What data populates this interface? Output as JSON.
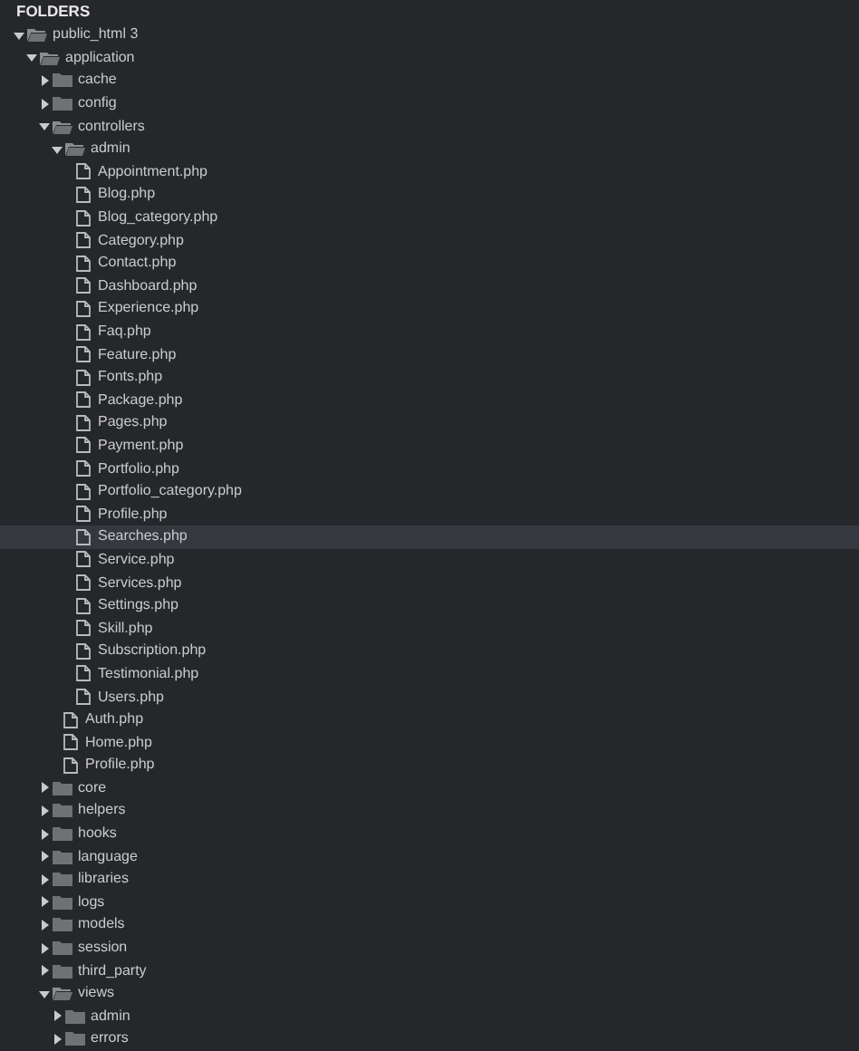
{
  "sidebar": {
    "title": "FOLDERS",
    "tree": [
      {
        "kind": "folder",
        "name": "public_html 3",
        "expanded": true,
        "selected": false,
        "children": [
          {
            "kind": "folder",
            "name": "application",
            "expanded": true,
            "selected": false,
            "children": [
              {
                "kind": "folder",
                "name": "cache",
                "expanded": false,
                "selected": false
              },
              {
                "kind": "folder",
                "name": "config",
                "expanded": false,
                "selected": false
              },
              {
                "kind": "folder",
                "name": "controllers",
                "expanded": true,
                "selected": false,
                "children": [
                  {
                    "kind": "folder",
                    "name": "admin",
                    "expanded": true,
                    "selected": false,
                    "children": [
                      {
                        "kind": "file",
                        "name": "Appointment.php",
                        "selected": false
                      },
                      {
                        "kind": "file",
                        "name": "Blog.php",
                        "selected": false
                      },
                      {
                        "kind": "file",
                        "name": "Blog_category.php",
                        "selected": false
                      },
                      {
                        "kind": "file",
                        "name": "Category.php",
                        "selected": false
                      },
                      {
                        "kind": "file",
                        "name": "Contact.php",
                        "selected": false
                      },
                      {
                        "kind": "file",
                        "name": "Dashboard.php",
                        "selected": false
                      },
                      {
                        "kind": "file",
                        "name": "Experience.php",
                        "selected": false
                      },
                      {
                        "kind": "file",
                        "name": "Faq.php",
                        "selected": false
                      },
                      {
                        "kind": "file",
                        "name": "Feature.php",
                        "selected": false
                      },
                      {
                        "kind": "file",
                        "name": "Fonts.php",
                        "selected": false
                      },
                      {
                        "kind": "file",
                        "name": "Package.php",
                        "selected": false
                      },
                      {
                        "kind": "file",
                        "name": "Pages.php",
                        "selected": false
                      },
                      {
                        "kind": "file",
                        "name": "Payment.php",
                        "selected": false
                      },
                      {
                        "kind": "file",
                        "name": "Portfolio.php",
                        "selected": false
                      },
                      {
                        "kind": "file",
                        "name": "Portfolio_category.php",
                        "selected": false
                      },
                      {
                        "kind": "file",
                        "name": "Profile.php",
                        "selected": false
                      },
                      {
                        "kind": "file",
                        "name": "Searches.php",
                        "selected": true
                      },
                      {
                        "kind": "file",
                        "name": "Service.php",
                        "selected": false
                      },
                      {
                        "kind": "file",
                        "name": "Services.php",
                        "selected": false
                      },
                      {
                        "kind": "file",
                        "name": "Settings.php",
                        "selected": false
                      },
                      {
                        "kind": "file",
                        "name": "Skill.php",
                        "selected": false
                      },
                      {
                        "kind": "file",
                        "name": "Subscription.php",
                        "selected": false
                      },
                      {
                        "kind": "file",
                        "name": "Testimonial.php",
                        "selected": false
                      },
                      {
                        "kind": "file",
                        "name": "Users.php",
                        "selected": false
                      }
                    ]
                  },
                  {
                    "kind": "file",
                    "name": "Auth.php",
                    "selected": false
                  },
                  {
                    "kind": "file",
                    "name": "Home.php",
                    "selected": false
                  },
                  {
                    "kind": "file",
                    "name": "Profile.php",
                    "selected": false
                  }
                ]
              },
              {
                "kind": "folder",
                "name": "core",
                "expanded": false,
                "selected": false
              },
              {
                "kind": "folder",
                "name": "helpers",
                "expanded": false,
                "selected": false
              },
              {
                "kind": "folder",
                "name": "hooks",
                "expanded": false,
                "selected": false
              },
              {
                "kind": "folder",
                "name": "language",
                "expanded": false,
                "selected": false
              },
              {
                "kind": "folder",
                "name": "libraries",
                "expanded": false,
                "selected": false
              },
              {
                "kind": "folder",
                "name": "logs",
                "expanded": false,
                "selected": false
              },
              {
                "kind": "folder",
                "name": "models",
                "expanded": false,
                "selected": false
              },
              {
                "kind": "folder",
                "name": "session",
                "expanded": false,
                "selected": false
              },
              {
                "kind": "folder",
                "name": "third_party",
                "expanded": false,
                "selected": false
              },
              {
                "kind": "folder",
                "name": "views",
                "expanded": true,
                "selected": false,
                "children": [
                  {
                    "kind": "folder",
                    "name": "admin",
                    "expanded": false,
                    "selected": false
                  },
                  {
                    "kind": "folder",
                    "name": "errors",
                    "expanded": false,
                    "selected": false
                  }
                ]
              }
            ]
          }
        ]
      }
    ]
  }
}
